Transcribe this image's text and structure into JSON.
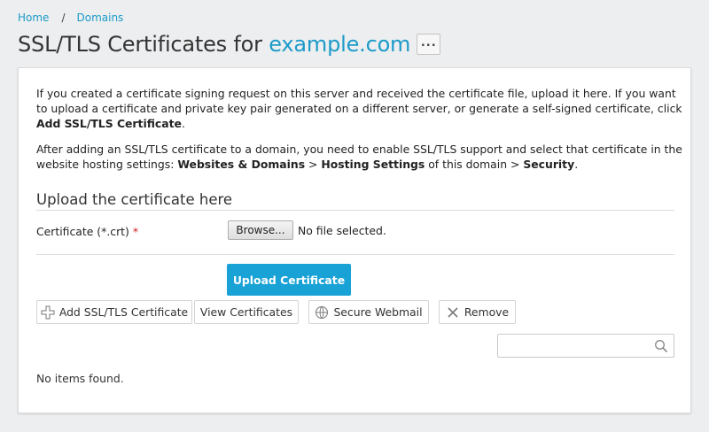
{
  "breadcrumb": {
    "home": "Home",
    "separator": "/",
    "domains": "Domains"
  },
  "header": {
    "title_prefix": "SSL/TLS Certificates for ",
    "domain": "example.com",
    "more_label": "..."
  },
  "intro": {
    "p1_text": "If you created a certificate signing request on this server and received the certificate file, upload it here. If you want to upload a certificate and private key pair generated on a different server, or generate a self-signed certificate, click ",
    "p1_bold": "Add SSL/TLS Certificate",
    "p1_end": ".",
    "p2_text": "After adding an SSL/TLS certificate to a domain, you need to enable SSL/TLS support and select that certificate in the website hosting settings: ",
    "p2_bold1": "Websites & Domains",
    "p2_mid1": " > ",
    "p2_bold2": "Hosting Settings",
    "p2_mid2": " of this domain > ",
    "p2_bold3": "Security",
    "p2_end": "."
  },
  "upload": {
    "section_title": "Upload the certificate here",
    "field_label": "Certificate (*.crt)",
    "required_mark": "*",
    "browse_label": "Browse...",
    "file_status": "No file selected.",
    "submit_label": "Upload Certificate"
  },
  "toolbar": {
    "add_label": "Add SSL/TLS Certificate",
    "view_label": "View Certificates",
    "webmail_label": "Secure Webmail",
    "remove_label": "Remove"
  },
  "search": {
    "value": "",
    "icon": "search-icon"
  },
  "list": {
    "empty_text": "No items found."
  },
  "colors": {
    "accent": "#1d9bc9",
    "primary_button": "#18a2d6",
    "required": "#d02020"
  }
}
